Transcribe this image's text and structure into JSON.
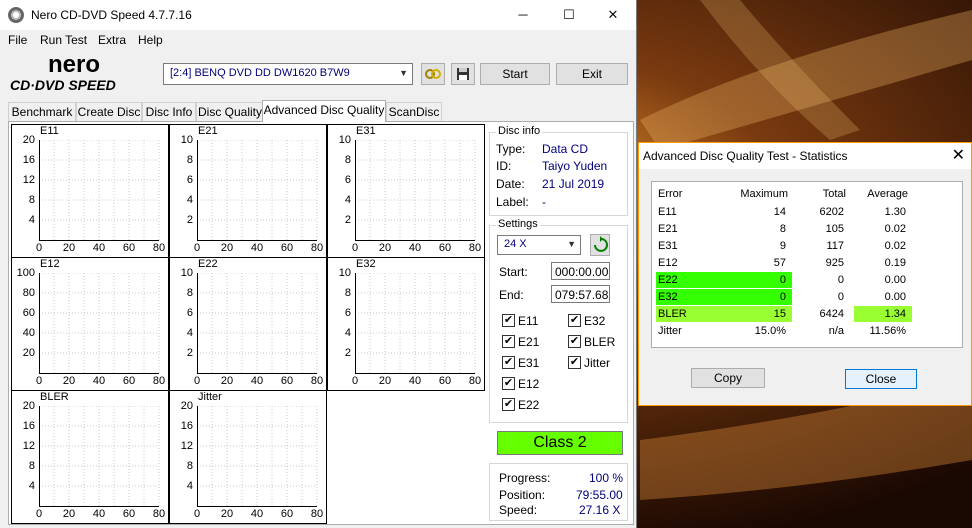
{
  "window": {
    "title": "Nero CD-DVD Speed 4.7.7.16",
    "min": "─",
    "max": "☐",
    "close": "✕"
  },
  "menu": [
    "File",
    "Run Test",
    "Extra",
    "Help"
  ],
  "logo": {
    "line1": "nero",
    "line2": "CD·DVD SPEED"
  },
  "toolbar": {
    "drive": "[2:4]   BENQ DVD DD DW1620 B7W9",
    "start": "Start",
    "exit": "Exit"
  },
  "tabs": [
    "Benchmark",
    "Create Disc",
    "Disc Info",
    "Disc Quality",
    "Advanced Disc Quality",
    "ScanDisc"
  ],
  "active_tab": 4,
  "charts": [
    {
      "label": "E11",
      "yticks": [
        "20",
        "16",
        "12",
        "8",
        "4"
      ],
      "ymax": 20,
      "xticks": [
        "0",
        "20",
        "40",
        "60",
        "80"
      ],
      "color": "#1a1a99"
    },
    {
      "label": "E21",
      "yticks": [
        "10",
        "8",
        "6",
        "4",
        "2"
      ],
      "ymax": 10,
      "xticks": [
        "0",
        "20",
        "40",
        "60",
        "80"
      ],
      "color": "#1a1a99"
    },
    {
      "label": "E31",
      "yticks": [
        "10",
        "8",
        "6",
        "4",
        "2"
      ],
      "ymax": 10,
      "xticks": [
        "0",
        "20",
        "40",
        "60",
        "80"
      ],
      "color": "#1a1a99"
    },
    {
      "label": "E12",
      "yticks": [
        "100",
        "80",
        "60",
        "40",
        "20"
      ],
      "ymax": 100,
      "xticks": [
        "0",
        "20",
        "40",
        "60",
        "80"
      ],
      "color": "#800080"
    },
    {
      "label": "E22",
      "yticks": [
        "10",
        "8",
        "6",
        "4",
        "2"
      ],
      "ymax": 10,
      "xticks": [
        "0",
        "20",
        "40",
        "60",
        "80"
      ],
      "color": "#1a1a99"
    },
    {
      "label": "E32",
      "yticks": [
        "10",
        "8",
        "6",
        "4",
        "2"
      ],
      "ymax": 10,
      "xticks": [
        "0",
        "20",
        "40",
        "60",
        "80"
      ],
      "color": "#1a1a99"
    },
    {
      "label": "BLER",
      "yticks": [
        "20",
        "16",
        "12",
        "8",
        "4"
      ],
      "ymax": 20,
      "xticks": [
        "0",
        "20",
        "40",
        "60",
        "80"
      ],
      "color": "#008000"
    },
    {
      "label": "Jitter",
      "yticks": [
        "20",
        "16",
        "12",
        "8",
        "4"
      ],
      "ymax": 20,
      "xticks": [
        "0",
        "20",
        "40",
        "60",
        "80"
      ],
      "color": "#800040"
    }
  ],
  "disc_info": {
    "title": "Disc info",
    "type_label": "Type:",
    "type": "Data CD",
    "id_label": "ID:",
    "id": "Taiyo Yuden",
    "date_label": "Date:",
    "date": "21 Jul 2019",
    "label_label": "Label:",
    "label": "-"
  },
  "settings": {
    "title": "Settings",
    "speed": "24 X",
    "start_label": "Start:",
    "start": "000:00.00",
    "end_label": "End:",
    "end": "079:57.68",
    "checks": [
      {
        "name": "E11",
        "checked": true
      },
      {
        "name": "E32",
        "checked": true
      },
      {
        "name": "E21",
        "checked": true
      },
      {
        "name": "BLER",
        "checked": true
      },
      {
        "name": "E31",
        "checked": true
      },
      {
        "name": "Jitter",
        "checked": true
      },
      {
        "name": "E12",
        "checked": true
      },
      {
        "name": "E22",
        "checked": true
      }
    ]
  },
  "class_label": "Class 2",
  "progress": {
    "progress_label": "Progress:",
    "progress": "100 %",
    "position_label": "Position:",
    "position": "79:55.00",
    "speed_label": "Speed:",
    "speed": "27.16 X"
  },
  "stats": {
    "title": "Advanced Disc Quality Test - Statistics",
    "close": "✕",
    "headers": [
      "Error",
      "Maximum",
      "Total",
      "Average"
    ],
    "rows": [
      {
        "error": "E11",
        "max": "14",
        "total": "6202",
        "avg": "1.30"
      },
      {
        "error": "E21",
        "max": "8",
        "total": "105",
        "avg": "0.02"
      },
      {
        "error": "E31",
        "max": "9",
        "total": "117",
        "avg": "0.02"
      },
      {
        "error": "E12",
        "max": "57",
        "total": "925",
        "avg": "0.19"
      },
      {
        "error": "E22",
        "max": "0",
        "total": "0",
        "avg": "0.00"
      },
      {
        "error": "E32",
        "max": "0",
        "total": "0",
        "avg": "0.00"
      },
      {
        "error": "BLER",
        "max": "15",
        "total": "6424",
        "avg": "1.34"
      },
      {
        "error": "Jitter",
        "max": "15.0%",
        "total": "n/a",
        "avg": "11.56%"
      }
    ],
    "copy": "Copy",
    "close_btn": "Close"
  }
}
